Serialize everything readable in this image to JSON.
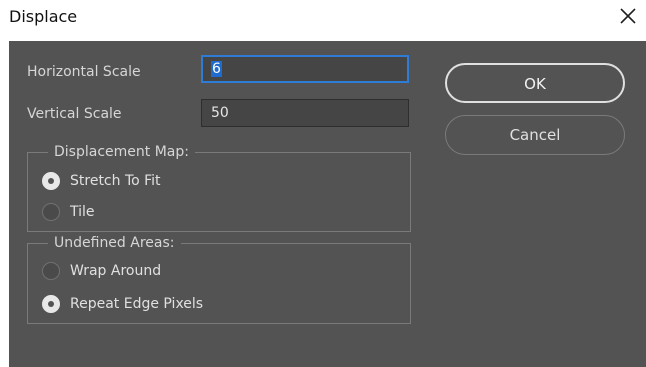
{
  "window": {
    "title": "Displace",
    "close_icon": "close-icon"
  },
  "fields": {
    "horizontal_scale": {
      "label": "Horizontal Scale",
      "value": "6"
    },
    "vertical_scale": {
      "label": "Vertical Scale",
      "value": "50"
    }
  },
  "buttons": {
    "ok": "OK",
    "cancel": "Cancel"
  },
  "displacement_map": {
    "legend": "Displacement Map:",
    "options": [
      {
        "label": "Stretch To Fit",
        "checked": true
      },
      {
        "label": "Tile",
        "checked": false
      }
    ]
  },
  "undefined_areas": {
    "legend": "Undefined Areas:",
    "options": [
      {
        "label": "Wrap Around",
        "checked": false
      },
      {
        "label": "Repeat Edge Pixels",
        "checked": true
      }
    ]
  },
  "colors": {
    "panel_bg": "#535353",
    "focus_border": "#2f7cd6",
    "selection": "#1f6cd1"
  }
}
